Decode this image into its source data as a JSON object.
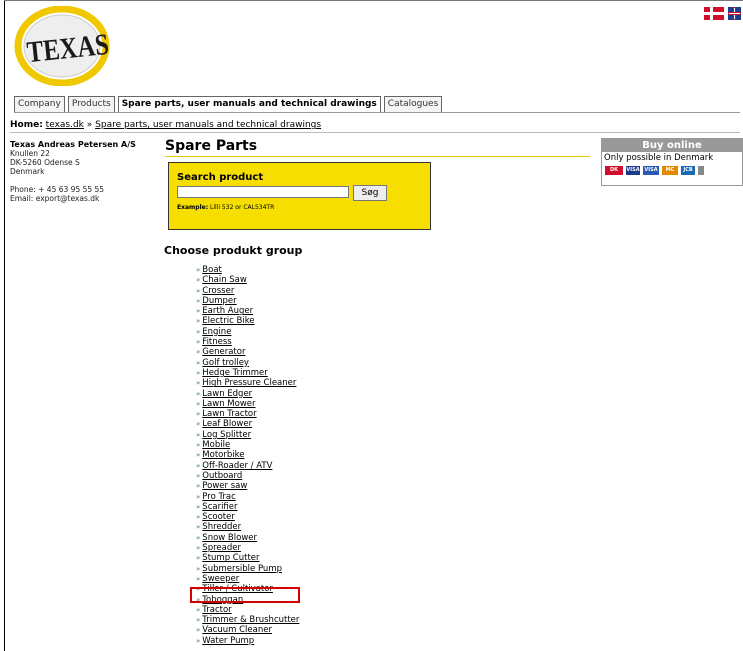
{
  "logo": {
    "text": "TEXAS",
    "ring_color": "#f0c800",
    "brand_color": "#1a1a1a"
  },
  "flags": [
    {
      "name": "danish-flag-icon"
    },
    {
      "name": "uk-flag-icon"
    }
  ],
  "tabs": [
    {
      "label": "Company"
    },
    {
      "label": "Products"
    },
    {
      "label": "Spare parts, user manuals and technical drawings",
      "active": true
    },
    {
      "label": "Catalogues"
    }
  ],
  "breadcrumb": {
    "home_label": "Home:",
    "site": "texas.dk",
    "separator": "»",
    "current": "Spare parts, user manuals and technical drawings"
  },
  "company": {
    "name": "Texas Andreas Petersen A/S",
    "street": "Knullen 22",
    "city": "DK-5260 Odense S",
    "country": "Denmark",
    "phone": "Phone: + 45 63 95 55 55",
    "email": "Email: export@texas.dk"
  },
  "main": {
    "title": "Spare Parts"
  },
  "search": {
    "title": "Search product",
    "value": "",
    "button_label": "Søg",
    "example_label": "Example:",
    "example_text": "Lilli 532 or CAL534TR",
    "box_color": "#f6df00"
  },
  "groups": {
    "title": "Choose produkt group",
    "arrow": "»",
    "items": [
      "Boat",
      "Chain Saw",
      "Crosser",
      "Dumper",
      "Earth Auger",
      "Electric Bike",
      "Engine",
      "Fitness",
      "Generator",
      "Golf trolley",
      "Hedge Trimmer",
      "High Pressure Cleaner",
      "Lawn Edger",
      "Lawn Mower",
      "Lawn Tractor",
      "Leaf Blower",
      "Log Splitter",
      "Mobile",
      "Motorbike",
      "Off-Roader / ATV",
      "Outboard",
      "Power saw",
      "Pro Trac",
      "Scarifier",
      "Scooter",
      "Shredder",
      "Snow Blower",
      "Spreader",
      "Stump Cutter",
      "Submersible Pump",
      "Sweeper",
      "Tiller / Cultivator",
      "Toboggan",
      "Tractor",
      "Trimmer & Brushcutter",
      "Vacuum Cleaner",
      "Water Pump"
    ],
    "highlighted": "Tiller / Cultivator",
    "highlight_color": "#d60000"
  },
  "buy_online": {
    "title": "Buy online",
    "note": "Only possible in Denmark",
    "cards": [
      {
        "label": "DK",
        "color": "#d0102a"
      },
      {
        "label": "VISA",
        "color": "#1a3a8a"
      },
      {
        "label": "VISA",
        "color": "#2a5ab0"
      },
      {
        "label": "MC",
        "color": "#e08a00"
      },
      {
        "label": "JCB",
        "color": "#1a6ab0"
      },
      {
        "label": "",
        "color": "#888888"
      }
    ]
  }
}
